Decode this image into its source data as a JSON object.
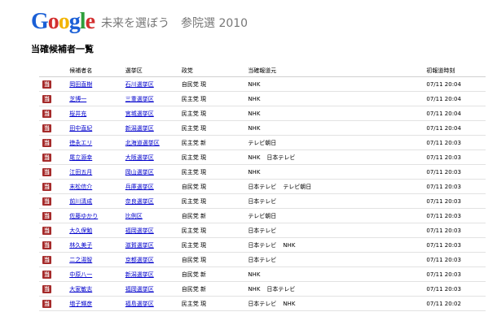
{
  "header": {
    "logo": "Google",
    "tagline": "未来を選ぼう　参院選 2010"
  },
  "section_title": "当確候補者一覧",
  "table": {
    "columns": [
      "候補者名",
      "選挙区",
      "政党",
      "当確報道元",
      "初報道時刻"
    ],
    "rows": [
      {
        "name": "岡田直樹",
        "district": "石川選挙区",
        "party": "自民党 現",
        "media": [
          "NHK"
        ],
        "time": "07/11 20:04"
      },
      {
        "name": "芝博一",
        "district": "三重選挙区",
        "party": "民主党 現",
        "media": [
          "NHK"
        ],
        "time": "07/11 20:04"
      },
      {
        "name": "桜井充",
        "district": "宮城選挙区",
        "party": "民主党 現",
        "media": [
          "NHK"
        ],
        "time": "07/11 20:04"
      },
      {
        "name": "田中直紀",
        "district": "新潟選挙区",
        "party": "民主党 現",
        "media": [
          "NHK"
        ],
        "time": "07/11 20:04"
      },
      {
        "name": "徳永エリ",
        "district": "北海道選挙区",
        "party": "民主党 新",
        "media": [
          "テレビ朝日"
        ],
        "time": "07/11 20:03"
      },
      {
        "name": "尾立源幸",
        "district": "大阪選挙区",
        "party": "民主党 現",
        "media": [
          "NHK",
          "日本テレビ"
        ],
        "time": "07/11 20:03"
      },
      {
        "name": "江田五月",
        "district": "岡山選挙区",
        "party": "民主党 現",
        "media": [
          "NHK"
        ],
        "time": "07/11 20:03"
      },
      {
        "name": "末松信介",
        "district": "兵庫選挙区",
        "party": "自民党 現",
        "media": [
          "日本テレビ",
          "テレビ朝日"
        ],
        "time": "07/11 20:03"
      },
      {
        "name": "前川清成",
        "district": "奈良選挙区",
        "party": "民主党 現",
        "media": [
          "日本テレビ"
        ],
        "time": "07/11 20:03"
      },
      {
        "name": "佐藤ゆかり",
        "district": "比例区",
        "party": "自民党 新",
        "media": [
          "テレビ朝日"
        ],
        "time": "07/11 20:03"
      },
      {
        "name": "大久保勉",
        "district": "福岡選挙区",
        "party": "民主党 現",
        "media": [
          "日本テレビ"
        ],
        "time": "07/11 20:03"
      },
      {
        "name": "林久美子",
        "district": "滋賀選挙区",
        "party": "民主党 現",
        "media": [
          "日本テレビ",
          "NHK"
        ],
        "time": "07/11 20:03"
      },
      {
        "name": "二之湯智",
        "district": "京都選挙区",
        "party": "自民党 現",
        "media": [
          "日本テレビ"
        ],
        "time": "07/11 20:03"
      },
      {
        "name": "中原八一",
        "district": "新潟選挙区",
        "party": "自民党 新",
        "media": [
          "NHK"
        ],
        "time": "07/11 20:03"
      },
      {
        "name": "大家敏志",
        "district": "福岡選挙区",
        "party": "自民党 新",
        "media": [
          "NHK",
          "日本テレビ"
        ],
        "time": "07/11 20:03"
      },
      {
        "name": "増子輝彦",
        "district": "福島選挙区",
        "party": "民主党 現",
        "media": [
          "日本テレビ",
          "NHK"
        ],
        "time": "07/11 20:02"
      }
    ]
  },
  "icon": {
    "name": "election-win-icon",
    "color": "#a52a2a",
    "glyph": "当"
  }
}
